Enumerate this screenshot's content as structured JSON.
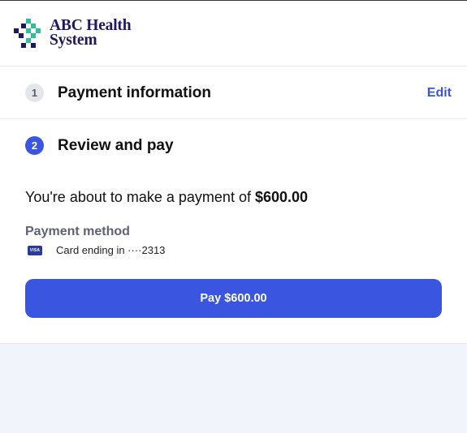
{
  "brand": {
    "name_line1": "ABC Health",
    "name_line2": "System",
    "colors": {
      "teal": "#2fbf9f",
      "navy": "#1d1862",
      "accent": "#3a55e0"
    }
  },
  "steps": [
    {
      "number": "1",
      "title": "Payment information",
      "action": "Edit",
      "state": "completed"
    },
    {
      "number": "2",
      "title": "Review and pay",
      "state": "active"
    }
  ],
  "review": {
    "summary_prefix": "You're about to make a payment of ",
    "amount": "$600.00",
    "payment_method_label": "Payment method",
    "card_brand_icon": "visa-card-icon",
    "card_brand_text": "VISA",
    "card_text": "Card ending in ····2313",
    "pay_button_label": "Pay $600.00"
  }
}
